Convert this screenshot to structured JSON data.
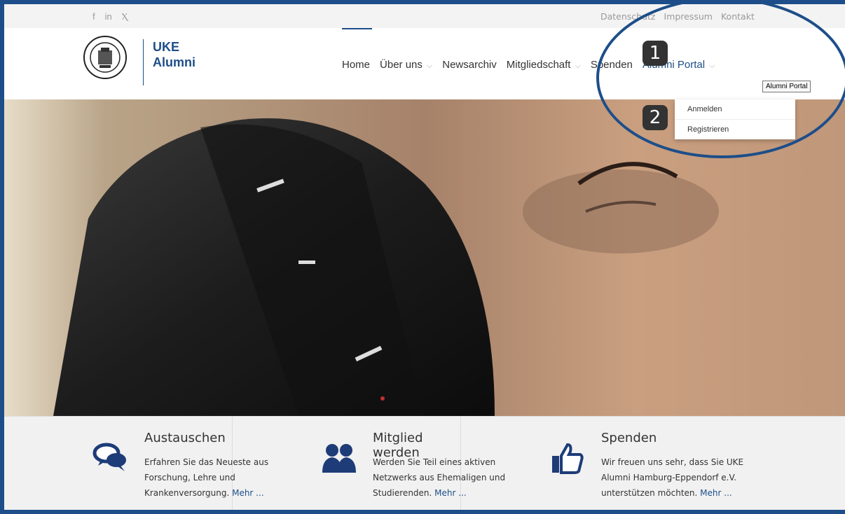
{
  "topbar": {
    "social": [
      "f",
      "in",
      "Ⲭ"
    ],
    "links": [
      "Datenschutz",
      "Impressum",
      "Kontakt"
    ]
  },
  "logo": {
    "line1": "UKE",
    "line2": "Alumni"
  },
  "nav": {
    "items": [
      "Home",
      "Über uns",
      "Newsarchiv",
      "Mitgliedschaft",
      "Spenden",
      "Alumni Portal"
    ],
    "active": "Alumni Portal"
  },
  "tooltip": "Alumni Portal",
  "dropdown": {
    "items": [
      "Anmelden",
      "Registrieren"
    ]
  },
  "badges": [
    "1",
    "2"
  ],
  "features": [
    {
      "title": "Austauschen",
      "text": "Erfahren Sie das Neueste aus Forschung, Lehre und Krankenversorgung.",
      "more": "Mehr ...",
      "icon": "chat-bubbles-icon"
    },
    {
      "title": "Mitglied werden",
      "text": "Werden Sie Teil eines aktiven Netzwerks aus Ehemaligen und Studierenden.",
      "more": "Mehr ...",
      "icon": "users-icon"
    },
    {
      "title": "Spenden",
      "text": "Wir freuen uns sehr, dass Sie UKE Alumni Hamburg-Eppendorf e.V. unterstützen möchten.",
      "more": "Mehr ...",
      "icon": "thumbs-up-icon"
    }
  ],
  "colors": {
    "brand": "#1d4e89",
    "annotation": "#1d4e89"
  }
}
